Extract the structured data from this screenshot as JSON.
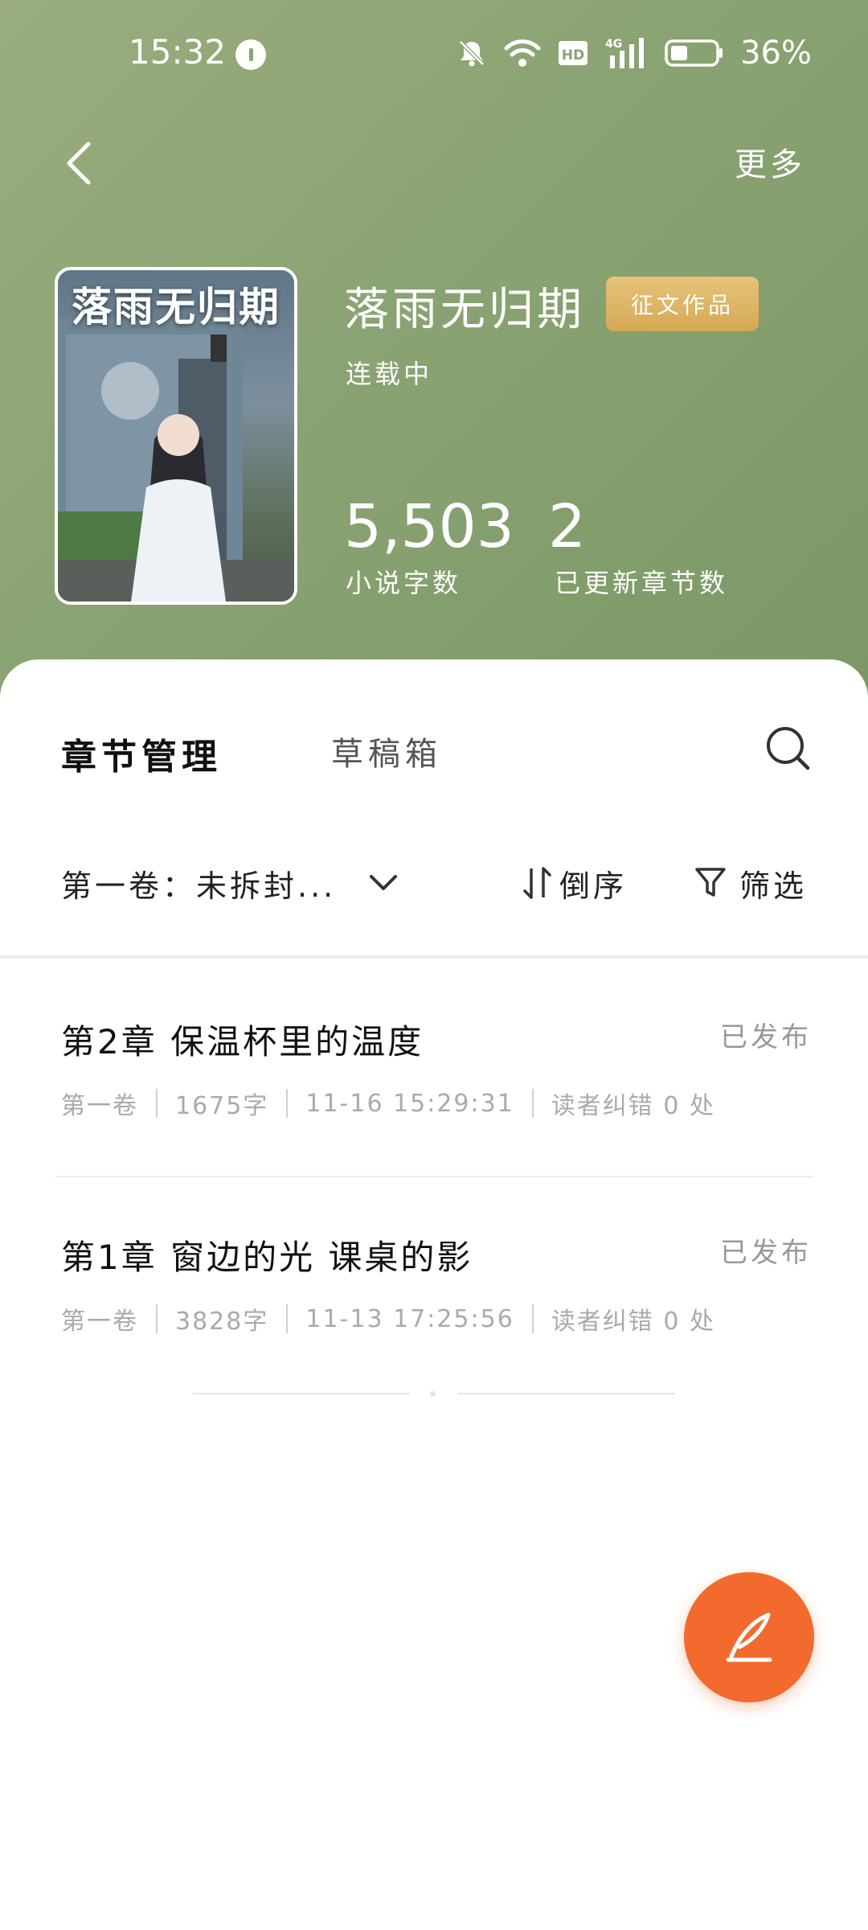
{
  "status_bar": {
    "time": "15:32",
    "battery_pct": "36%",
    "network_label": "HD",
    "signal_label": "4G"
  },
  "nav": {
    "more_label": "更多"
  },
  "book": {
    "cover_text": "落雨无归期",
    "title": "落雨无归期",
    "badge": "征文作品",
    "serial_status": "连载中",
    "word_count": "5,503",
    "word_count_label": "小说字数",
    "chapter_count": "2",
    "chapter_count_label": "已更新章节数"
  },
  "tabs": {
    "active": "章节管理",
    "inactive": "草稿箱"
  },
  "toolbar": {
    "volume": "第一卷：未拆封...",
    "sort_label": "倒序",
    "filter_label": "筛选"
  },
  "chapters": [
    {
      "title": "第2章 保温杯里的温度",
      "status": "已发布",
      "volume": "第一卷",
      "words": "1675字",
      "datetime": "11-16 15:29:31",
      "errata": "读者纠错 0 处"
    },
    {
      "title": "第1章 窗边的光 课桌的影",
      "status": "已发布",
      "volume": "第一卷",
      "words": "3828字",
      "datetime": "11-13 17:25:56",
      "errata": "读者纠错 0 处"
    }
  ],
  "colors": {
    "hero_green": "#8aa373",
    "badge_gold": "#d4a955",
    "fab_orange": "#f26a2e"
  },
  "icons": [
    "back-icon",
    "search-icon",
    "chevron-down-icon",
    "sort-icon",
    "filter-icon",
    "quill-icon",
    "mute-bell-icon",
    "wifi-icon",
    "signal-icon",
    "battery-icon"
  ]
}
